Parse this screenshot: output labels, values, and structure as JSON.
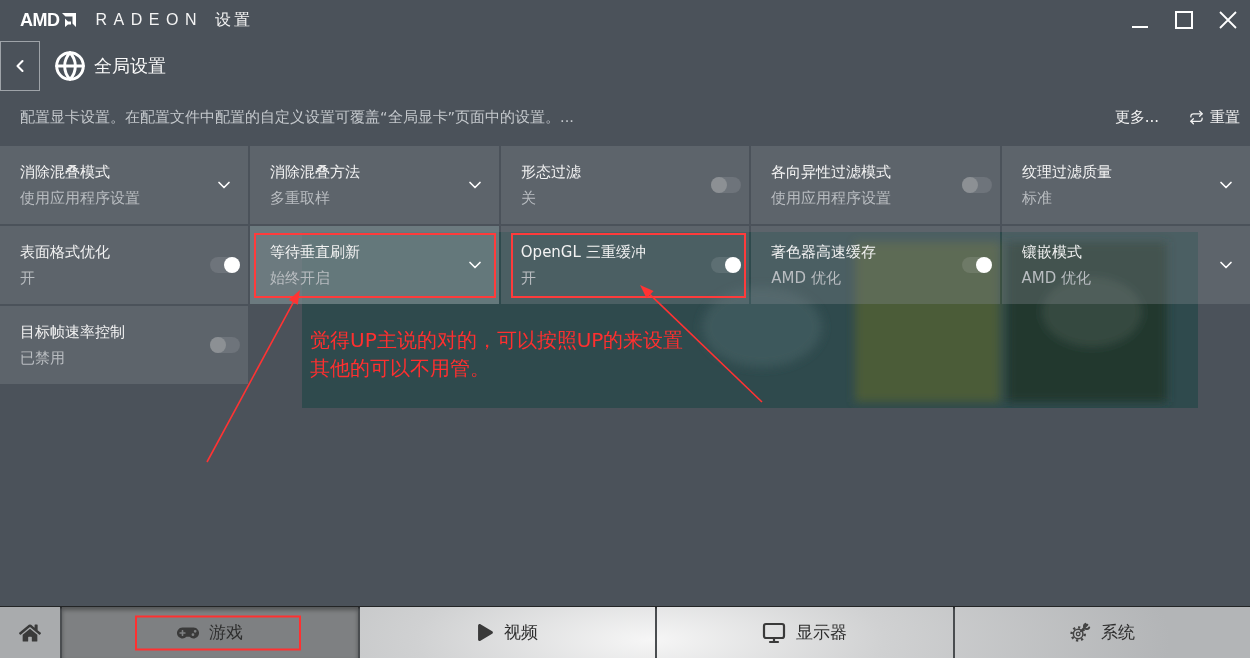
{
  "title_bar": {
    "brand": "AMD",
    "product": "RADEON",
    "title": "设置"
  },
  "header": {
    "title": "全局设置"
  },
  "description": "配置显卡设置。在配置文件中配置的自定义设置可覆盖“全局显卡”页面中的设置。...",
  "actions": [
    {
      "kind": "more",
      "label": "更多..."
    },
    {
      "kind": "reset",
      "label": "重置"
    }
  ],
  "settings": [
    {
      "kind": "dropdown",
      "label": "消除混叠模式",
      "value": "使用应用程序设置",
      "hovered": false,
      "annotated": false
    },
    {
      "kind": "dropdown",
      "label": "消除混叠方法",
      "value": "多重取样",
      "hovered": false,
      "annotated": false
    },
    {
      "kind": "toggle",
      "label": "形态过滤",
      "value": "关",
      "on": false,
      "hovered": false,
      "annotated": false
    },
    {
      "kind": "toggle",
      "label": "各向异性过滤模式",
      "value": "使用应用程序设置",
      "on": false,
      "hovered": false,
      "annotated": false
    },
    {
      "kind": "dropdown",
      "label": "纹理过滤质量",
      "value": "标准",
      "hovered": false,
      "annotated": false
    },
    {
      "kind": "toggle",
      "label": "表面格式优化",
      "value": "开",
      "on": true,
      "hovered": false,
      "annotated": false
    },
    {
      "kind": "dropdown",
      "label": "等待垂直刷新",
      "value": "始终开启",
      "hovered": true,
      "annotated": true
    },
    {
      "kind": "toggle",
      "label": "OpenGL 三重缓冲",
      "value": "开",
      "on": true,
      "hovered": false,
      "annotated": true
    },
    {
      "kind": "toggle",
      "label": "著色器高速缓存",
      "value": "AMD 优化",
      "on": true,
      "hovered": false,
      "annotated": false
    },
    {
      "kind": "dropdown",
      "label": "镶嵌模式",
      "value": "AMD 优化",
      "hovered": false,
      "annotated": false
    },
    {
      "kind": "toggle",
      "label": "目标帧速率控制",
      "value": "已禁用",
      "on": false,
      "hovered": false,
      "annotated": false
    }
  ],
  "annotation": {
    "lines": [
      "觉得UP主说的对的，可以按照UP的来设置",
      "其他的可以不用管。"
    ]
  },
  "bottom_nav": [
    {
      "kind": "home",
      "selected": false,
      "annotated": false
    },
    {
      "kind": "games",
      "label": "游戏",
      "selected": true,
      "annotated": true
    },
    {
      "kind": "video",
      "label": "视频",
      "selected": false,
      "annotated": false
    },
    {
      "kind": "display",
      "label": "显示器",
      "selected": false,
      "annotated": false
    },
    {
      "kind": "system",
      "label": "系统",
      "selected": false,
      "annotated": false
    }
  ]
}
